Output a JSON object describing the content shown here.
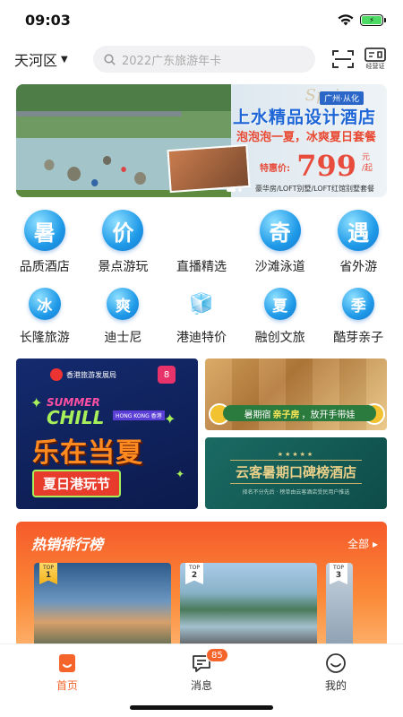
{
  "status": {
    "time": "09:03"
  },
  "header": {
    "city": "天河区",
    "search_placeholder": "2022广东旅游年卡",
    "license_label": "经营证"
  },
  "banner": {
    "spring": "Spring",
    "tag": "广州·从化",
    "headline": "上水精品设计酒店",
    "subline": "泡泡泡一夏，冰爽夏日套餐",
    "price_label": "特惠价:",
    "price": "799",
    "price_unit_top": "元",
    "price_unit_bottom": "/起",
    "rooms": "豪华房/LOFT别墅/LOFT红馆别墅套餐"
  },
  "categories_row1": [
    {
      "glyph": "暑",
      "label": "品质酒店"
    },
    {
      "glyph": "价",
      "label": "景点游玩"
    },
    {
      "glyph": "🏝",
      "label": "直播精选"
    },
    {
      "glyph": "奇",
      "label": "沙滩泳道"
    },
    {
      "glyph": "遇",
      "label": "省外游"
    }
  ],
  "categories_row2": [
    {
      "glyph": "冰",
      "label": "长隆旅游"
    },
    {
      "glyph": "爽",
      "label": "迪士尼"
    },
    {
      "glyph": "🧊",
      "label": "港迪特价"
    },
    {
      "glyph": "夏",
      "label": "融创文旅"
    },
    {
      "glyph": "季",
      "label": "酷芽亲子"
    }
  ],
  "promo": {
    "left": {
      "org": "香港旅游发展局",
      "summer": "SUMMER",
      "chill": "CHILL",
      "hk": "HONG KONG 香港",
      "title": "乐在当夏",
      "pill": "夏日港玩节"
    },
    "right_top": {
      "text_a": "暑期宿",
      "text_b": "亲子房",
      "text_c": "，放开手带娃"
    },
    "right_bottom": {
      "stars": "★★★★★",
      "title": "云客暑期口碑榜酒店",
      "sub": "择名不分先后 · 榜单由云客酒店受民用户推选"
    }
  },
  "ranking": {
    "title": "热销排行榜",
    "more": "全部",
    "cards": [
      {
        "rank": "1"
      },
      {
        "rank": "2"
      },
      {
        "rank": "3"
      }
    ],
    "top_label": "TOP"
  },
  "tabs": {
    "home": "首页",
    "messages": "消息",
    "mine": "我的",
    "msg_count": "85"
  },
  "colors": {
    "accent": "#f5642b",
    "blue": "#1f9ae8"
  }
}
